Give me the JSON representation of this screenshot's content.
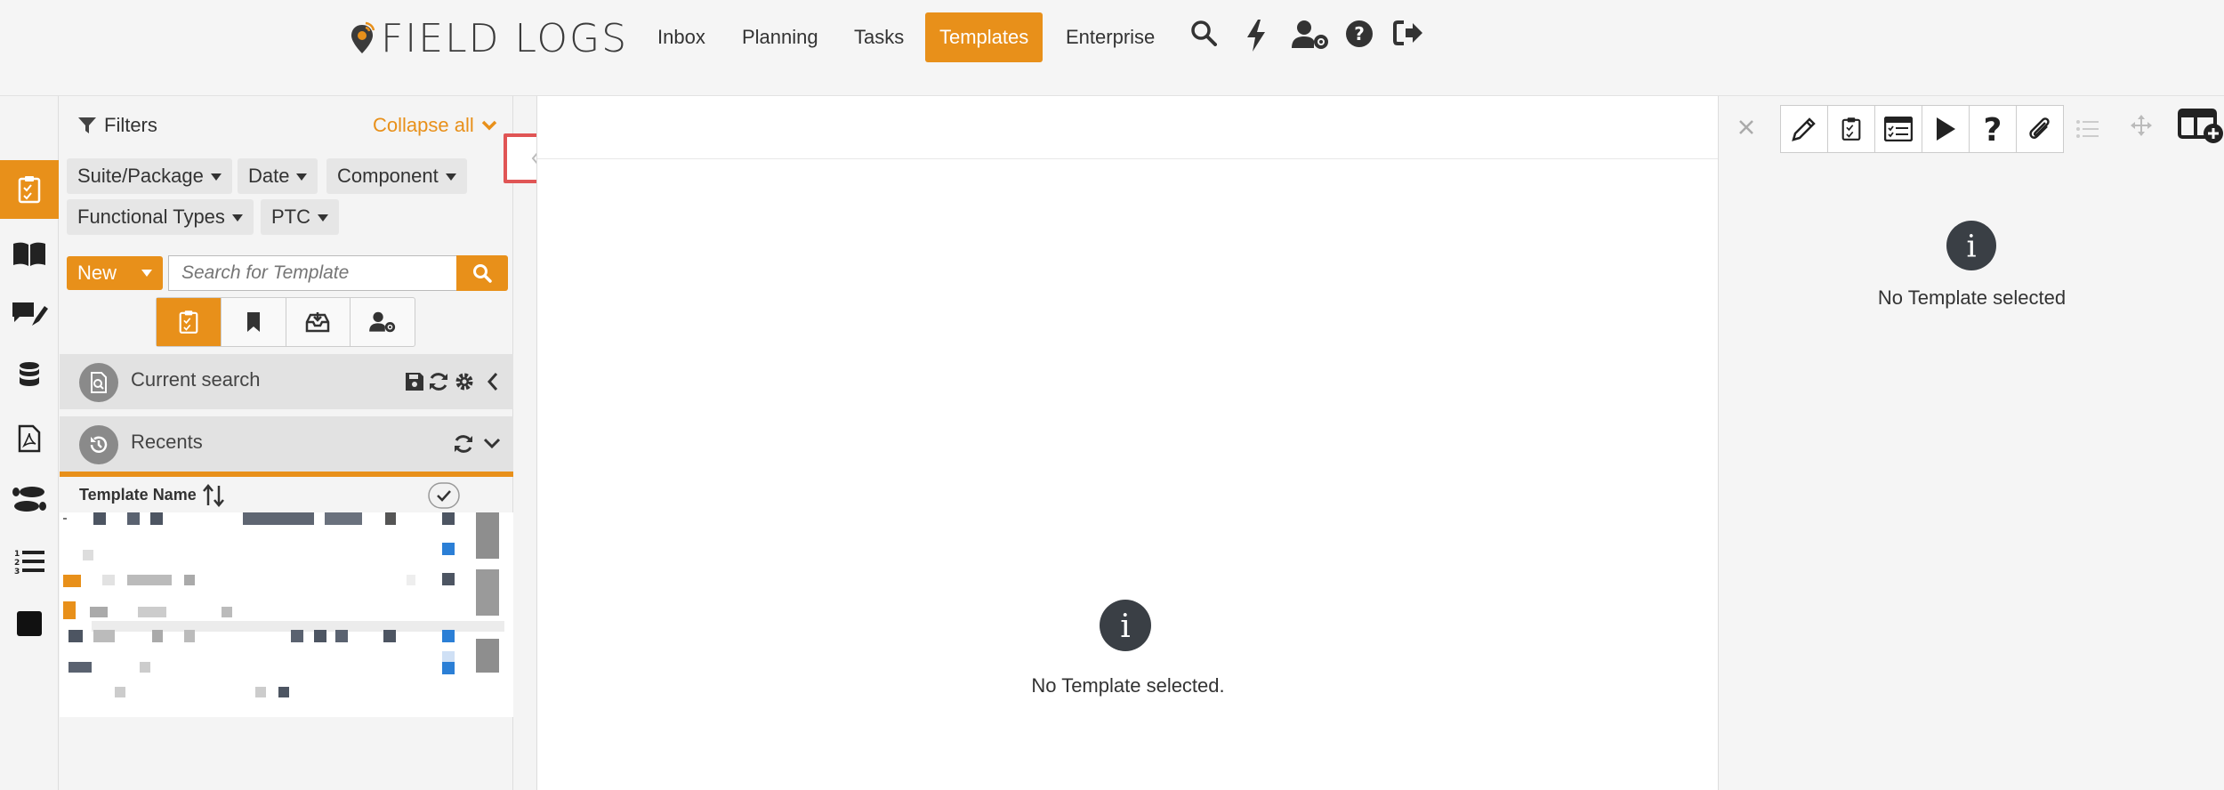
{
  "app": {
    "logo_text": "FIELD LOGS"
  },
  "nav": {
    "items": [
      {
        "label": "Inbox"
      },
      {
        "label": "Planning"
      },
      {
        "label": "Tasks"
      },
      {
        "label": "Templates",
        "active": true
      },
      {
        "label": "Enterprise"
      }
    ]
  },
  "header_icons": [
    "search-icon",
    "bolt-icon",
    "user-gear-icon",
    "help-icon",
    "logout-icon"
  ],
  "rail": {
    "items": [
      "clipboard-check-icon",
      "book-icon",
      "comment-edit-icon",
      "database-icon",
      "pdf-file-icon",
      "footprints-icon",
      "ordered-list-icon",
      "square-icon"
    ],
    "active_index": 0
  },
  "filters": {
    "title": "Filters",
    "collapse_label": "Collapse all",
    "pills": [
      "Suite/Package",
      "Date",
      "Component",
      "Functional Types",
      "PTC"
    ]
  },
  "search": {
    "new_label": "New",
    "placeholder": "Search for Template"
  },
  "sections": {
    "current_search": "Current search",
    "recents": "Recents"
  },
  "table": {
    "header_name": "Template Name"
  },
  "main": {
    "empty_message": "No Template selected."
  },
  "right": {
    "empty_message": "No Template selected"
  },
  "colors": {
    "accent": "#e8901a",
    "highlight_border": "#e05555",
    "info_circle": "#3a3f45"
  }
}
